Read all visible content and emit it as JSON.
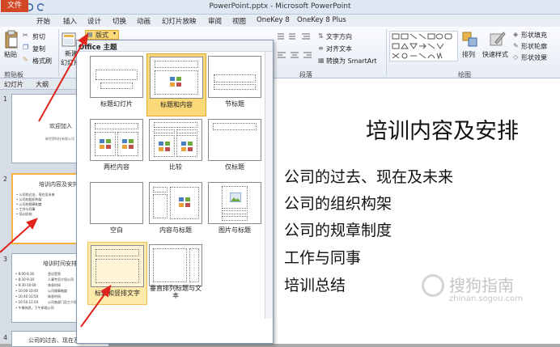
{
  "window": {
    "title": "PowerPoint.pptx - Microsoft PowerPoint"
  },
  "tabs": [
    {
      "label": "文件"
    },
    {
      "label": "开始"
    },
    {
      "label": "插入"
    },
    {
      "label": "设计"
    },
    {
      "label": "切换"
    },
    {
      "label": "动画"
    },
    {
      "label": "幻灯片放映"
    },
    {
      "label": "审阅"
    },
    {
      "label": "视图"
    },
    {
      "label": "OneKey 8"
    },
    {
      "label": "OneKey 8 Plus"
    }
  ],
  "ribbon": {
    "paste_label": "粘贴",
    "cut_label": "剪切",
    "copy_label": "复制",
    "format_painter_label": "格式刷",
    "clipboard_group": "剪贴板",
    "new_slide_label": "新建\n幻灯片",
    "new_slide_line1": "新建",
    "new_slide_line2": "幻灯片",
    "layout_button": "版式",
    "slides_group_partial": "幻",
    "text_direction": "文字方向",
    "align_text": "对齐文本",
    "convert_smartart": "转换为 SmartArt",
    "paragraph_group": "段落",
    "arrange_label": "排列",
    "quick_styles_label": "快速样式",
    "shape_fill": "形状填充",
    "shape_outline": "形状轮廓",
    "shape_effects": "形状效果",
    "drawing_group": "绘图"
  },
  "pane": {
    "tab_slides": "幻灯片",
    "tab_outline": "大纲",
    "thumbs": [
      {
        "num": "1",
        "title": "欢迎加入",
        "sub": "新世界科技有限公司"
      },
      {
        "num": "2",
        "title": "培训内容及安排",
        "lines": [
          "公司的过去、现在及未来",
          "公司的组织构架",
          "公司的规章制度",
          "工作与同事",
          "培训总结"
        ]
      },
      {
        "num": "3",
        "title": "培训时间安排",
        "rows": [
          [
            "8:00-8:30",
            "会议签到"
          ],
          [
            "8:30-9:30",
            "人事专员介绍公司"
          ],
          [
            "9:30-10:00",
            "休息时间"
          ],
          [
            "10:00-10:40",
            "公司规章制度"
          ],
          [
            "10:40-10:50",
            "休息时间"
          ],
          [
            "10:50-11:50",
            "公司各部门员工介绍"
          ],
          [
            "",
            "午餐休息，下午参观公司"
          ]
        ]
      },
      {
        "num": "4",
        "title": "公司的过去、现在及未来"
      }
    ]
  },
  "dropdown": {
    "header": "Office 主题",
    "layouts": [
      {
        "label": "标题幻灯片"
      },
      {
        "label": "标题和内容"
      },
      {
        "label": "节标题"
      },
      {
        "label": "两栏内容"
      },
      {
        "label": "比较"
      },
      {
        "label": "仅标题"
      },
      {
        "label": "空白"
      },
      {
        "label": "内容与标题"
      },
      {
        "label": "图片与标题"
      },
      {
        "label": "标题和竖排文字"
      },
      {
        "label": "垂直排列标题与文本"
      },
      {
        "label": "垂直排列标题与文\n本"
      }
    ]
  },
  "slide": {
    "title": "培训内容及安排",
    "bullets": [
      "公司的过去、现在及未来",
      "公司的组织构架",
      "公司的规章制度",
      "工作与同事",
      "培训总结"
    ]
  },
  "watermark": {
    "text": "搜狗指南",
    "url": "zhinan.sogou.com"
  },
  "colors": {
    "file_tab": "#d24726",
    "selected_layout": "#fbd979",
    "arrow": "#e0241b"
  }
}
